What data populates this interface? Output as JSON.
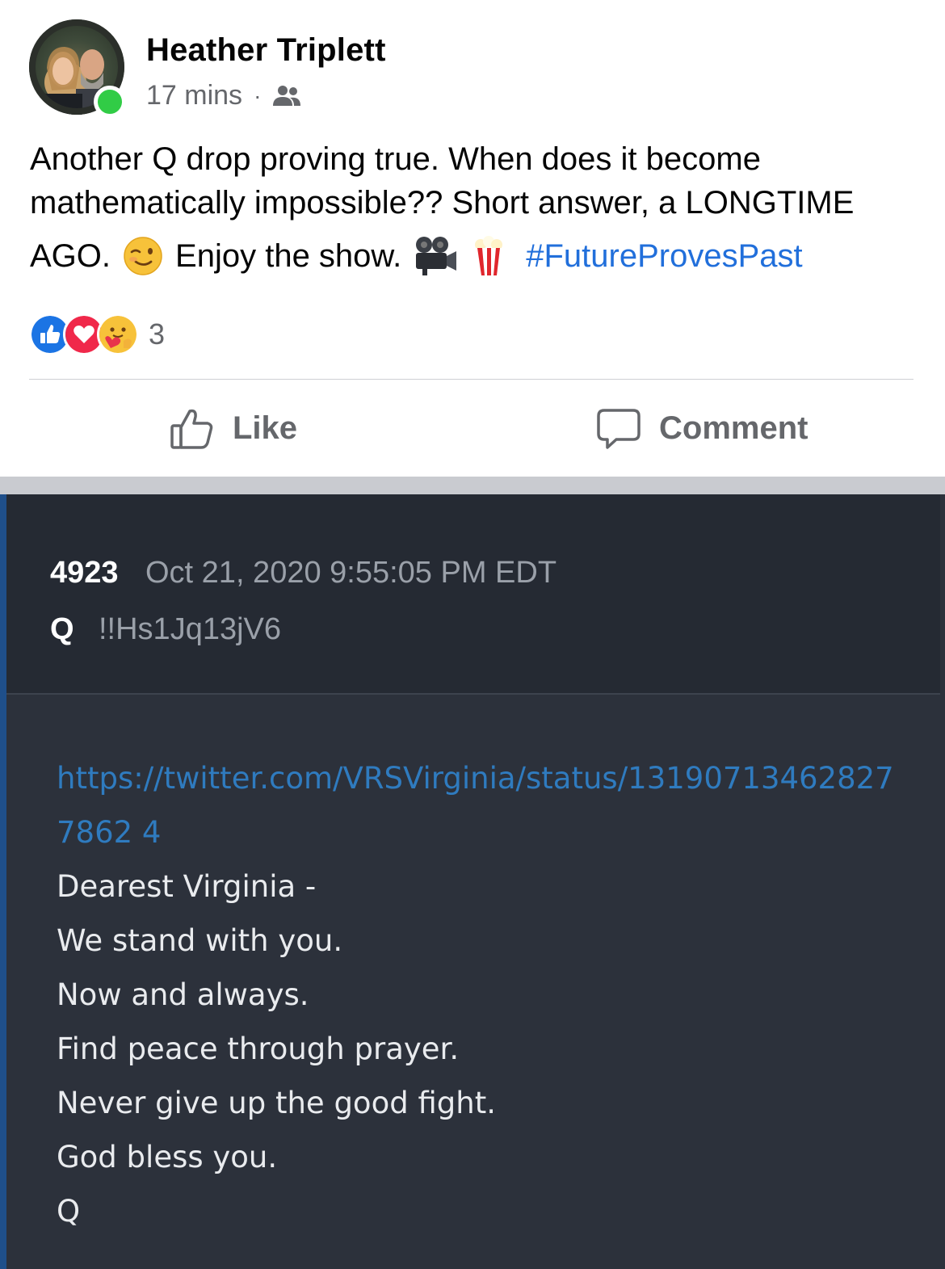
{
  "post": {
    "author": "Heather Triplett",
    "time": "17 mins",
    "separator": "·",
    "audience_icon": "friends-icon",
    "text_line1": "Another Q drop proving true. When does it become",
    "text_line2": "mathematically impossible?? Short answer, a LONGTIME",
    "text_line3_a": "AGO.",
    "text_line3_b": "Enjoy the show.",
    "hashtag": "#FutureProvesPast",
    "emojis": [
      "winking-face-emoji",
      "movie-camera-emoji",
      "popcorn-emoji"
    ],
    "reactions": [
      "like",
      "love",
      "care"
    ],
    "reaction_count": "3",
    "actions": {
      "like": "Like",
      "comment": "Comment"
    }
  },
  "drop": {
    "number": "4923",
    "date": "Oct 21, 2020 9:55:05 PM EDT",
    "author": "Q",
    "tripcode": "!!Hs1Jq13jV6",
    "link": "https://twitter.com/VRSVirginia/status/131907134628277862 4",
    "lines": [
      "Dearest Virginia -",
      "We stand with you.",
      "Now and always.",
      "Find peace through prayer.",
      "Never give up the good fight.",
      "God bless you.",
      "Q"
    ]
  },
  "colors": {
    "hashtag": "#216fdb",
    "secondary_text": "#65676b",
    "online": "#31cc46",
    "drop_bg": "#2c313b",
    "drop_header_bg": "#252a33",
    "drop_link": "#2f7bbf"
  }
}
